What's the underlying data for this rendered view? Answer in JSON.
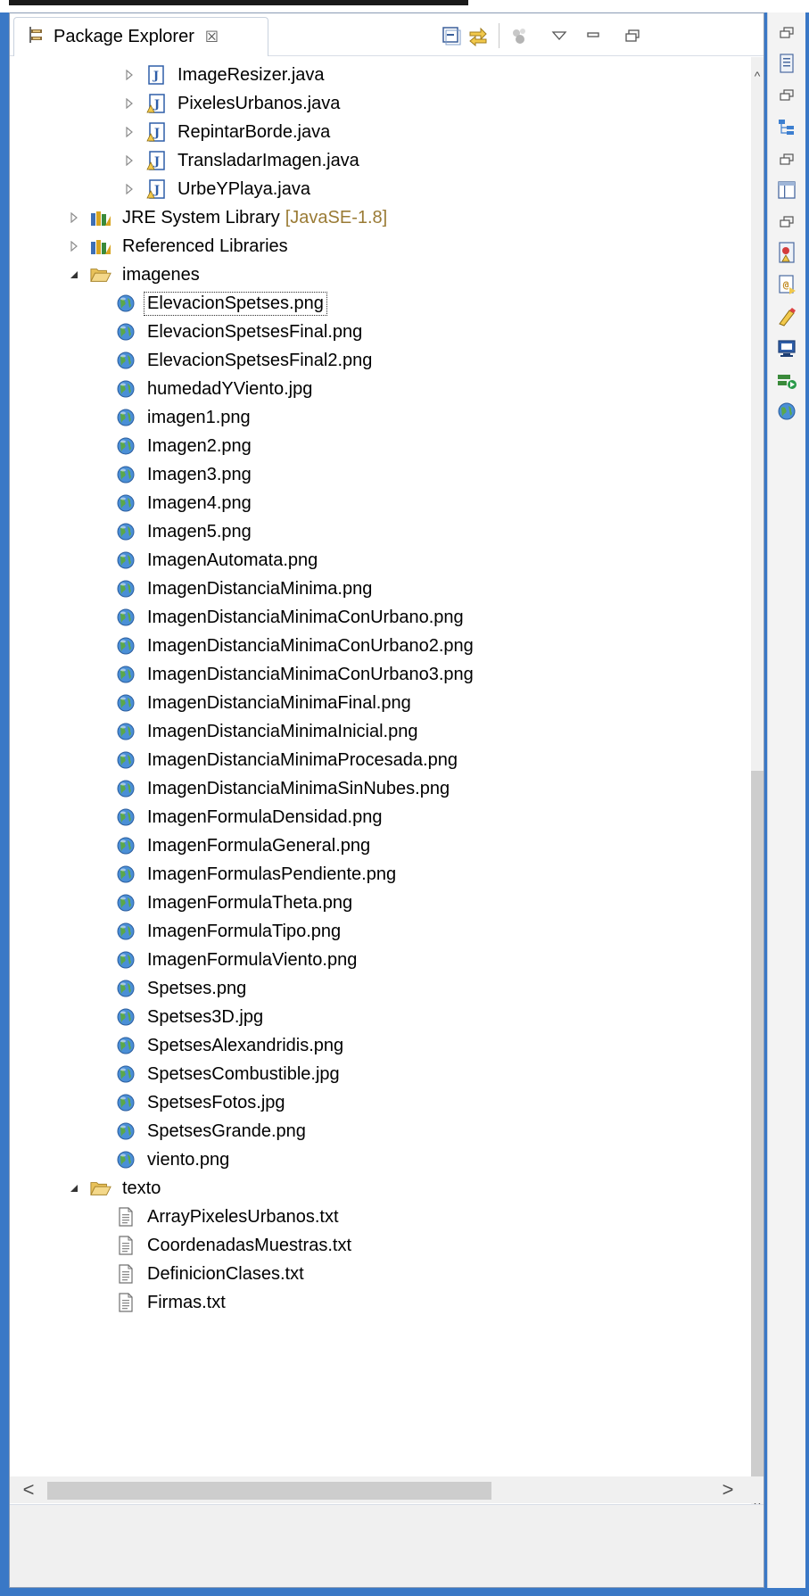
{
  "view": {
    "tab_title": "Package Explorer",
    "tab_close": "☒"
  },
  "tree": {
    "java_files": [
      {
        "label": "ImageResizer.java",
        "warning": false
      },
      {
        "label": "PixelesUrbanos.java",
        "warning": true
      },
      {
        "label": "RepintarBorde.java",
        "warning": true
      },
      {
        "label": "TransladarImagen.java",
        "warning": true
      },
      {
        "label": "UrbeYPlaya.java",
        "warning": true
      }
    ],
    "libraries": [
      {
        "label": "JRE System Library",
        "suffix": "[JavaSE-1.8]"
      },
      {
        "label": "Referenced Libraries",
        "suffix": ""
      }
    ],
    "imagenes": {
      "label": "imagenes",
      "files": [
        "ElevacionSpetses.png",
        "ElevacionSpetsesFinal.png",
        "ElevacionSpetsesFinal2.png",
        "humedadYViento.jpg",
        "imagen1.png",
        "Imagen2.png",
        "Imagen3.png",
        "Imagen4.png",
        "Imagen5.png",
        "ImagenAutomata.png",
        "ImagenDistanciaMinima.png",
        "ImagenDistanciaMinimaConUrbano.png",
        "ImagenDistanciaMinimaConUrbano2.png",
        "ImagenDistanciaMinimaConUrbano3.png",
        "ImagenDistanciaMinimaFinal.png",
        "ImagenDistanciaMinimaInicial.png",
        "ImagenDistanciaMinimaProcesada.png",
        "ImagenDistanciaMinimaSinNubes.png",
        "ImagenFormulaDensidad.png",
        "ImagenFormulaGeneral.png",
        "ImagenFormulasPendiente.png",
        "ImagenFormulaTheta.png",
        "ImagenFormulaTipo.png",
        "ImagenFormulaViento.png",
        "Spetses.png",
        "Spetses3D.jpg",
        "SpetsesAlexandridis.png",
        "SpetsesCombustible.jpg",
        "SpetsesFotos.jpg",
        "SpetsesGrande.png",
        "viento.png"
      ]
    },
    "texto": {
      "label": "texto",
      "files": [
        "ArrayPixelesUrbanos.txt",
        "CoordenadasMuestras.txt",
        "DefinicionClases.txt",
        "Firmas.txt"
      ]
    }
  },
  "colors": {
    "frame": "#3a78c6",
    "folder": "#e8c15a",
    "java_blue": "#2f5ea8",
    "suffix": "#9a7b35"
  },
  "icons": {
    "view": "package-explorer-icon",
    "collapse_all": "collapse-all-icon",
    "link_editor": "link-with-editor-icon",
    "focus": "focus-on-task-icon",
    "menu": "view-menu-icon",
    "minimize": "minimize-icon",
    "maximize": "restore-icon"
  }
}
